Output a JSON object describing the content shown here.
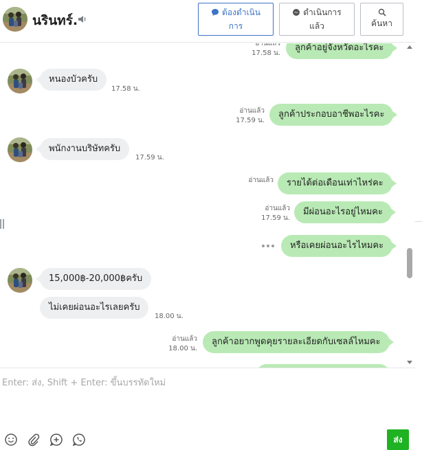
{
  "header": {
    "contact_name": "นรินทร์.",
    "buttons": {
      "todo_line1": "ต้องดำเนิน",
      "todo_line2": "การ",
      "done_line1": "ดำเนินการ",
      "done_line2": "แล้ว",
      "search": "ค้นหา"
    }
  },
  "messages": [
    {
      "side": "out",
      "text": "ลูกค้าอยู่จังหวัดอะไรคะ",
      "read_label": "อ่านแล้ว",
      "time": "17.58 น."
    },
    {
      "side": "in",
      "text": "หนองบัวครับ",
      "time": "17.58 น."
    },
    {
      "side": "out",
      "text": "ลูกค้าประกอบอาชีพอะไรคะ",
      "read_label": "อ่านแล้ว",
      "time": "17.59 น."
    },
    {
      "side": "in",
      "text": "พนักงานบริษัทครับ",
      "time": "17.59 น."
    },
    {
      "side": "out",
      "text": "รายได้ต่อเดือนเท่าไหร่คะ",
      "read_label": "อ่านแล้ว"
    },
    {
      "side": "out",
      "text": "มีผ่อนอะไรอยู่ไหมคะ",
      "read_label": "อ่านแล้ว",
      "time": "17.59 น."
    },
    {
      "side": "out",
      "text": "หรือเคยผ่อนอะไรไหมคะ"
    },
    {
      "side": "in",
      "text": "15,000฿-20,000฿ครับ"
    },
    {
      "side": "in",
      "text": "ไม่เคยผ่อนอะไรเลยครับ",
      "time": "18.00 น."
    },
    {
      "side": "out",
      "text": "ลูกค้าอยากพูดคุยรายละเอียดกับเซลล์ไหมคะ",
      "read_label": "อ่านแล้ว",
      "time": "18.00 น."
    }
  ],
  "composer": {
    "placeholder": "Enter: ส่ง, Shift + Enter: ขึ้นบรรทัดใหม่",
    "value": "",
    "send_label": "ส่ง",
    "tools": [
      "smile-icon",
      "paperclip-icon",
      "plus-circle-icon",
      "phone-bubble-icon"
    ]
  },
  "colors": {
    "outgoing_bubble": "#b9eab5",
    "incoming_bubble": "#eeeff1",
    "send_button": "#1fb223",
    "active_filter": "#3d73c6"
  }
}
